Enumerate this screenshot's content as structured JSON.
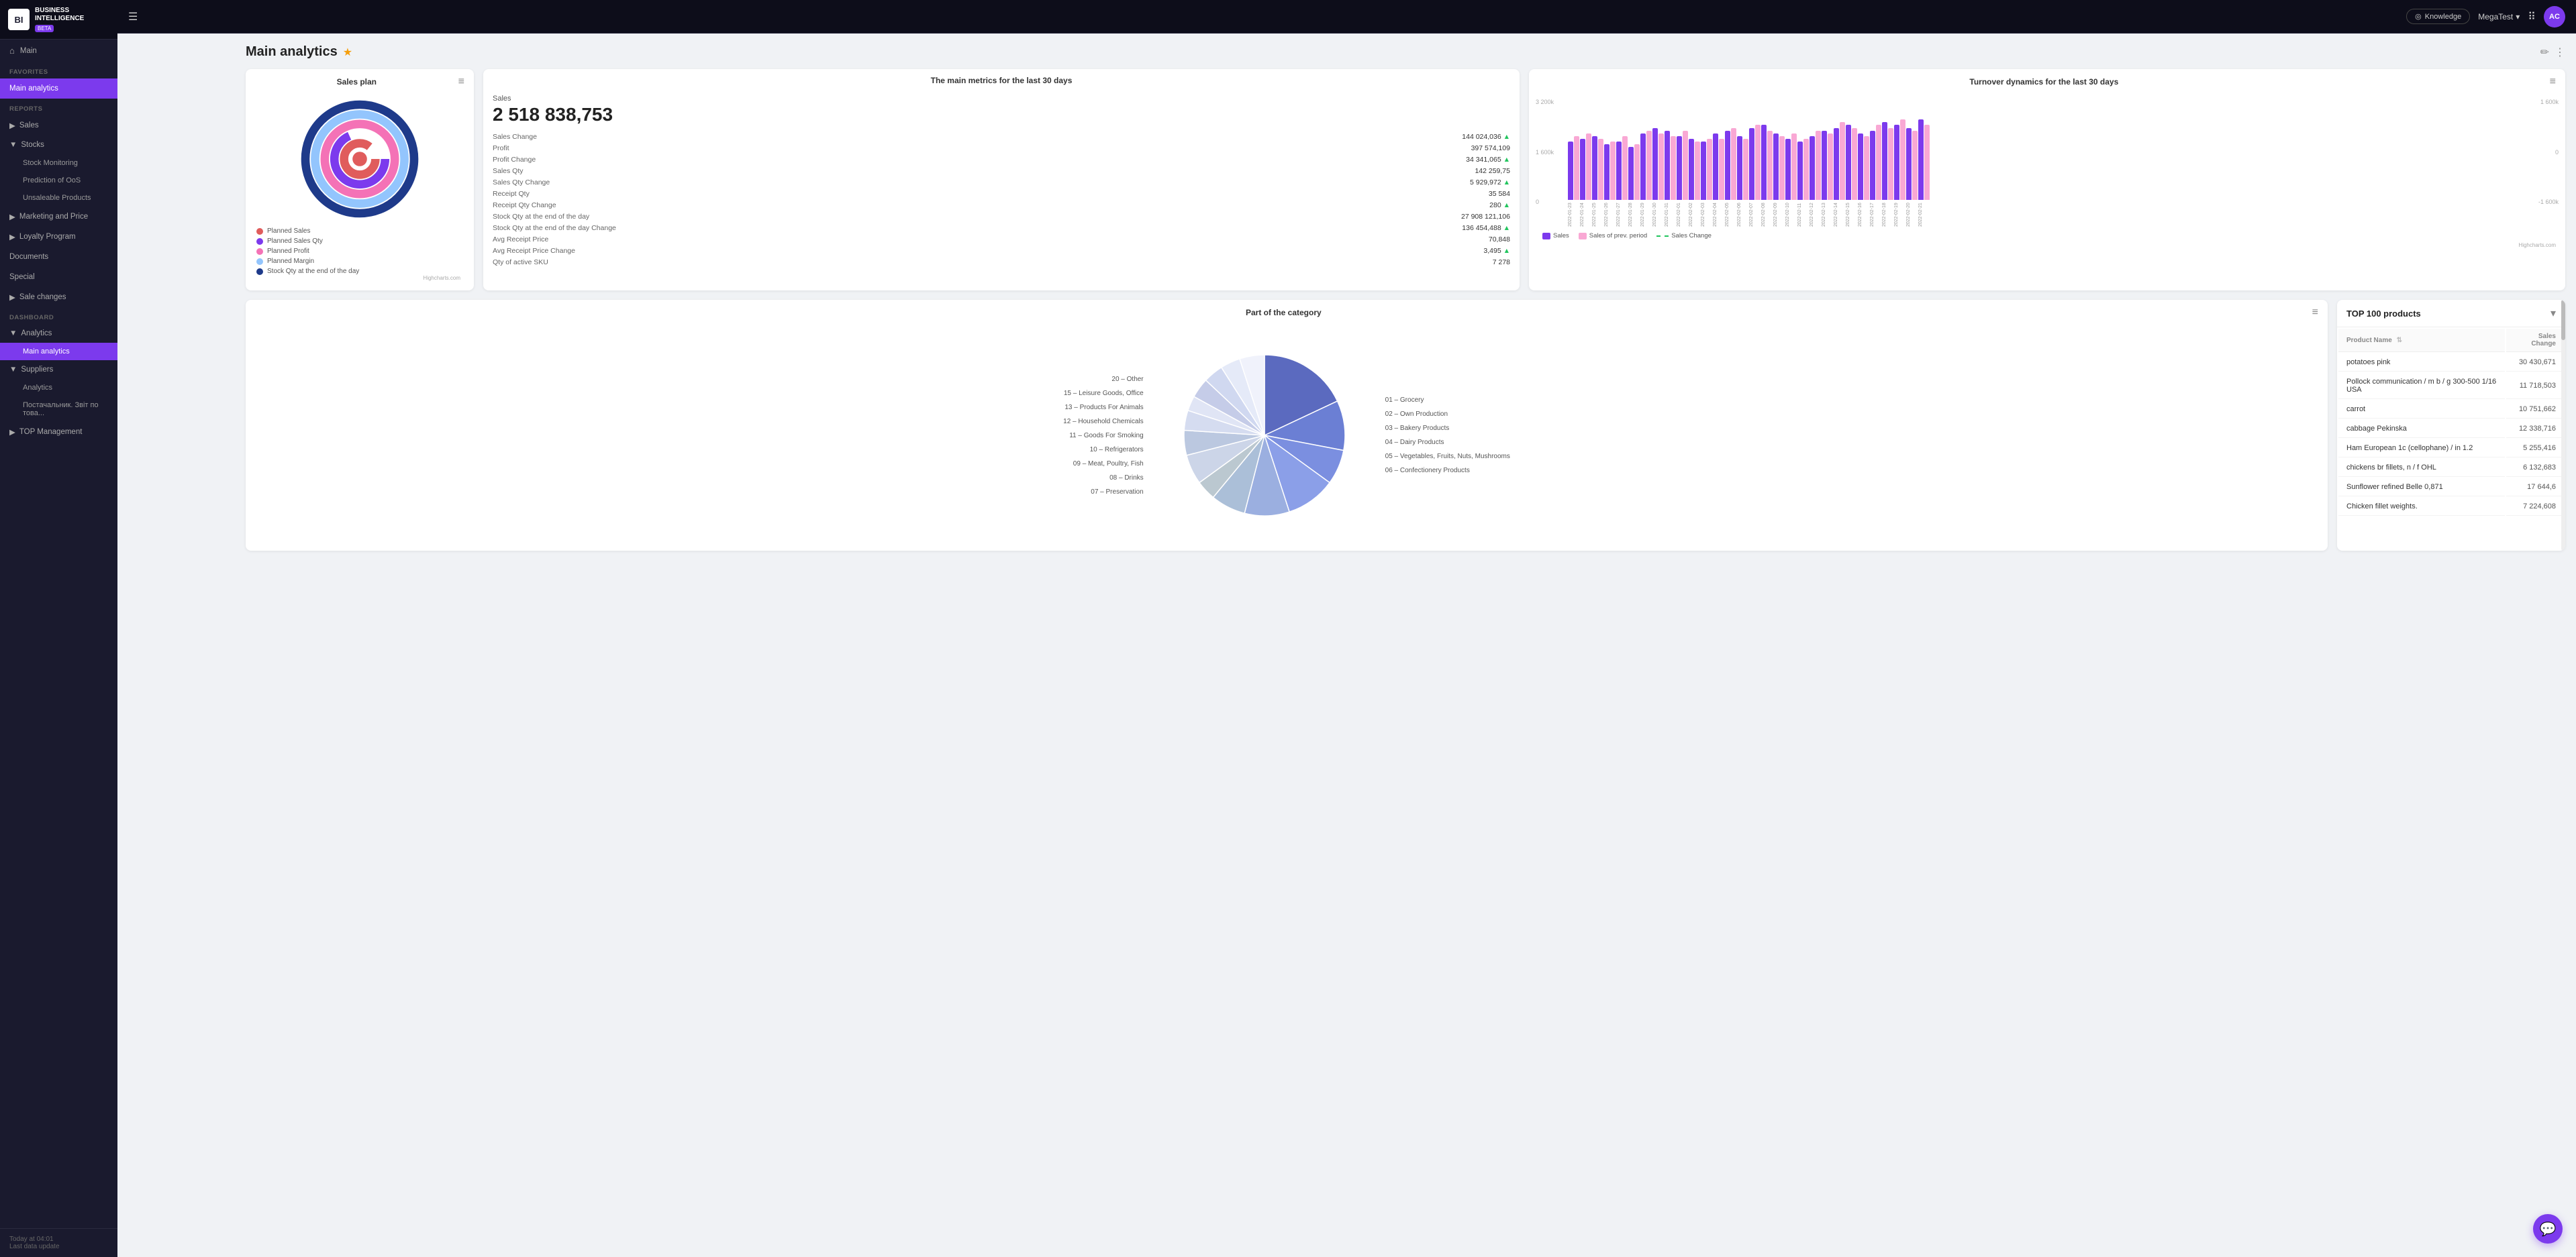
{
  "app": {
    "logo_letters": "BI",
    "logo_text_line1": "BUSINESS",
    "logo_text_line2": "INTELLIGENCE",
    "logo_beta": "BETA"
  },
  "topbar": {
    "hamburger": "☰",
    "knowledge_label": "Knowledge",
    "workspace": "MegaTest",
    "avatar_letters": "AC"
  },
  "sidebar": {
    "main_label": "Main",
    "section_favorites": "FAVORITES",
    "main_analytics_label": "Main analytics",
    "section_reports": "REPORTS",
    "sales_label": "Sales",
    "stocks_label": "Stocks",
    "stock_monitoring_label": "Stock Monitoring",
    "prediction_oos_label": "Prediction of OoS",
    "unsaleable_label": "Unsaleable Products",
    "marketing_label": "Marketing and Price",
    "loyalty_label": "Loyalty Program",
    "documents_label": "Documents",
    "special_label": "Special",
    "sale_changes_label": "Sale changes",
    "section_dashboard": "DASHBOARD",
    "analytics_label": "Analytics",
    "main_analytics_dash_label": "Main analytics",
    "suppliers_label": "Suppliers",
    "analytics_sub_label": "Analytics",
    "supplier_report_label": "Постачальник. Звіт по това...",
    "top_management_label": "TOP Management"
  },
  "sidebar_footer": {
    "time_label": "Today at 04:01",
    "data_label": "Last data update"
  },
  "page": {
    "title": "Main analytics",
    "star": "★",
    "edit_icon": "✏",
    "more_icon": "⋮"
  },
  "sales_plan": {
    "title": "Sales plan",
    "menu_icon": "≡",
    "legend": [
      {
        "color": "#e05c5c",
        "label": "Planned Sales"
      },
      {
        "color": "#7c3aed",
        "label": "Planned Sales Qty"
      },
      {
        "color": "#f472b6",
        "label": "Planned Profit"
      },
      {
        "color": "#93c5fd",
        "label": "Planned Margin"
      },
      {
        "color": "#1e3a8a",
        "label": "Stock Qty at the end of the day"
      }
    ],
    "highcharts": "Highcharts.com"
  },
  "metrics": {
    "title": "The main metrics for the last 30 days",
    "sales_label": "Sales",
    "sales_value": "2 518 838,753",
    "rows": [
      {
        "label": "Sales Change",
        "value": "144 024,036",
        "up": true
      },
      {
        "label": "Profit",
        "value": "397 574,109",
        "up": false
      },
      {
        "label": "Profit Change",
        "value": "34 341,065",
        "up": true
      },
      {
        "label": "Sales Qty",
        "value": "142 259,75",
        "up": false
      },
      {
        "label": "Sales Qty Change",
        "value": "5 929,972",
        "up": true
      },
      {
        "label": "Receipt Qty",
        "value": "35 584",
        "up": false
      },
      {
        "label": "Receipt Qty Change",
        "value": "280",
        "up": true
      },
      {
        "label": "Stock Qty at the end of the day",
        "value": "27 908 121,106",
        "up": false
      },
      {
        "label": "Stock Qty at the end of the day Change",
        "value": "136 454,488",
        "up": true
      },
      {
        "label": "Avg Receipt Price",
        "value": "70,848",
        "up": false
      },
      {
        "label": "Avg Receipt Price Change",
        "value": "3,495",
        "up": true
      },
      {
        "label": "Qty of active SKU",
        "value": "7 278",
        "up": false
      }
    ]
  },
  "turnover": {
    "title": "Turnover dynamics for the last 30 days",
    "menu_icon": "≡",
    "y_labels_left": [
      "3 200k",
      "1 600k",
      "0"
    ],
    "y_labels_right": [
      "1 600k",
      "0",
      "-1 600k"
    ],
    "legend": [
      {
        "type": "bar",
        "color": "#7c3aed",
        "label": "Sales"
      },
      {
        "type": "bar",
        "color": "#f9a8d4",
        "label": "Sales of prev. period"
      },
      {
        "type": "line",
        "color": "#22c55e",
        "label": "Sales Change"
      }
    ],
    "bars": [
      {
        "date": "2022-01-23",
        "s1": 2100,
        "s2": 2300
      },
      {
        "date": "2022-01-24",
        "s1": 2200,
        "s2": 2400
      },
      {
        "date": "2022-01-25",
        "s1": 2300,
        "s2": 2200
      },
      {
        "date": "2022-01-26",
        "s1": 2000,
        "s2": 2100
      },
      {
        "date": "2022-01-27",
        "s1": 2100,
        "s2": 2300
      },
      {
        "date": "2022-01-28",
        "s1": 1900,
        "s2": 2000
      },
      {
        "date": "2022-01-29",
        "s1": 2400,
        "s2": 2500
      },
      {
        "date": "2022-01-30",
        "s1": 2600,
        "s2": 2400
      },
      {
        "date": "2022-01-31",
        "s1": 2500,
        "s2": 2300
      },
      {
        "date": "2022-02-01",
        "s1": 2300,
        "s2": 2500
      },
      {
        "date": "2022-02-02",
        "s1": 2200,
        "s2": 2100
      },
      {
        "date": "2022-02-03",
        "s1": 2100,
        "s2": 2200
      },
      {
        "date": "2022-02-04",
        "s1": 2400,
        "s2": 2200
      },
      {
        "date": "2022-02-05",
        "s1": 2500,
        "s2": 2600
      },
      {
        "date": "2022-02-06",
        "s1": 2300,
        "s2": 2200
      },
      {
        "date": "2022-02-07",
        "s1": 2600,
        "s2": 2700
      },
      {
        "date": "2022-02-08",
        "s1": 2700,
        "s2": 2500
      },
      {
        "date": "2022-02-09",
        "s1": 2400,
        "s2": 2300
      },
      {
        "date": "2022-02-10",
        "s1": 2200,
        "s2": 2400
      },
      {
        "date": "2022-02-11",
        "s1": 2100,
        "s2": 2200
      },
      {
        "date": "2022-02-12",
        "s1": 2300,
        "s2": 2500
      },
      {
        "date": "2022-02-13",
        "s1": 2500,
        "s2": 2400
      },
      {
        "date": "2022-02-14",
        "s1": 2600,
        "s2": 2800
      },
      {
        "date": "2022-02-15",
        "s1": 2700,
        "s2": 2600
      },
      {
        "date": "2022-02-16",
        "s1": 2400,
        "s2": 2300
      },
      {
        "date": "2022-02-17",
        "s1": 2500,
        "s2": 2700
      },
      {
        "date": "2022-02-18",
        "s1": 2800,
        "s2": 2600
      },
      {
        "date": "2022-02-19",
        "s1": 2700,
        "s2": 2900
      },
      {
        "date": "2022-02-20",
        "s1": 2600,
        "s2": 2500
      },
      {
        "date": "2022-02-21",
        "s1": 2900,
        "s2": 2700
      }
    ],
    "highcharts": "Highcharts.com"
  },
  "pie_chart": {
    "title": "Part of the category",
    "menu_icon": "≡",
    "segments": [
      {
        "label": "01 – Grocery",
        "color": "#5b6abf",
        "pct": 0.18,
        "angle": 64.8
      },
      {
        "label": "02 – Own Production",
        "color": "#6b7fd4",
        "pct": 0.1,
        "angle": 36
      },
      {
        "label": "03 – Bakery Products",
        "color": "#7b8fe0",
        "pct": 0.07,
        "angle": 25.2
      },
      {
        "label": "04 – Dairy Products",
        "color": "#8b9fe8",
        "pct": 0.1,
        "angle": 36
      },
      {
        "label": "05 – Vegetables, Fruits, Nuts, Mushrooms",
        "color": "#9bafe0",
        "pct": 0.09,
        "angle": 32.4
      },
      {
        "label": "06 – Confectionery Products",
        "color": "#abbfd8",
        "pct": 0.07,
        "angle": 25.2
      },
      {
        "label": "07 – Preservation",
        "color": "#bbc8d0",
        "pct": 0.04,
        "angle": 14.4
      },
      {
        "label": "08 – Drinks",
        "color": "#ccd5e8",
        "pct": 0.06,
        "angle": 21.6
      },
      {
        "label": "09 – Meat, Poultry, Fish",
        "color": "#bbc8e0",
        "pct": 0.05,
        "angle": 18
      },
      {
        "label": "10 – Refrigerators",
        "color": "#d5dcf0",
        "pct": 0.04,
        "angle": 14.4
      },
      {
        "label": "11 – Goods For Smoking",
        "color": "#e0e5f5",
        "pct": 0.03,
        "angle": 10.8
      },
      {
        "label": "12 – Household Chemicals",
        "color": "#c5cce8",
        "pct": 0.04,
        "angle": 14.4
      },
      {
        "label": "13 – Products For Animals",
        "color": "#d0d8f0",
        "pct": 0.04,
        "angle": 14.4
      },
      {
        "label": "15 – Leisure Goods, Office",
        "color": "#e5eaf8",
        "pct": 0.04,
        "angle": 14.4
      },
      {
        "label": "20 – Other",
        "color": "#f0f2fb",
        "pct": 0.05,
        "angle": 18
      }
    ]
  },
  "top100": {
    "title": "TOP 100 products",
    "col_product": "Product Name",
    "col_change": "Sales Change",
    "rows": [
      {
        "name": "potatoes pink",
        "change": "30 430,671"
      },
      {
        "name": "Pollock communication / m b / g 300-500 1/16 USA",
        "change": "11 718,503"
      },
      {
        "name": "carrot",
        "change": "10 751,662"
      },
      {
        "name": "cabbage Pekinska",
        "change": "12 338,716"
      },
      {
        "name": "Ham European 1c (cellophane) / in 1.2",
        "change": "5 255,416"
      },
      {
        "name": "chickens br fillets, n / f OHL",
        "change": "6 132,683"
      },
      {
        "name": "Sunflower refined Belle 0,871",
        "change": "17 644,6"
      },
      {
        "name": "Chicken fillet weights.",
        "change": "7 224,608"
      }
    ]
  }
}
